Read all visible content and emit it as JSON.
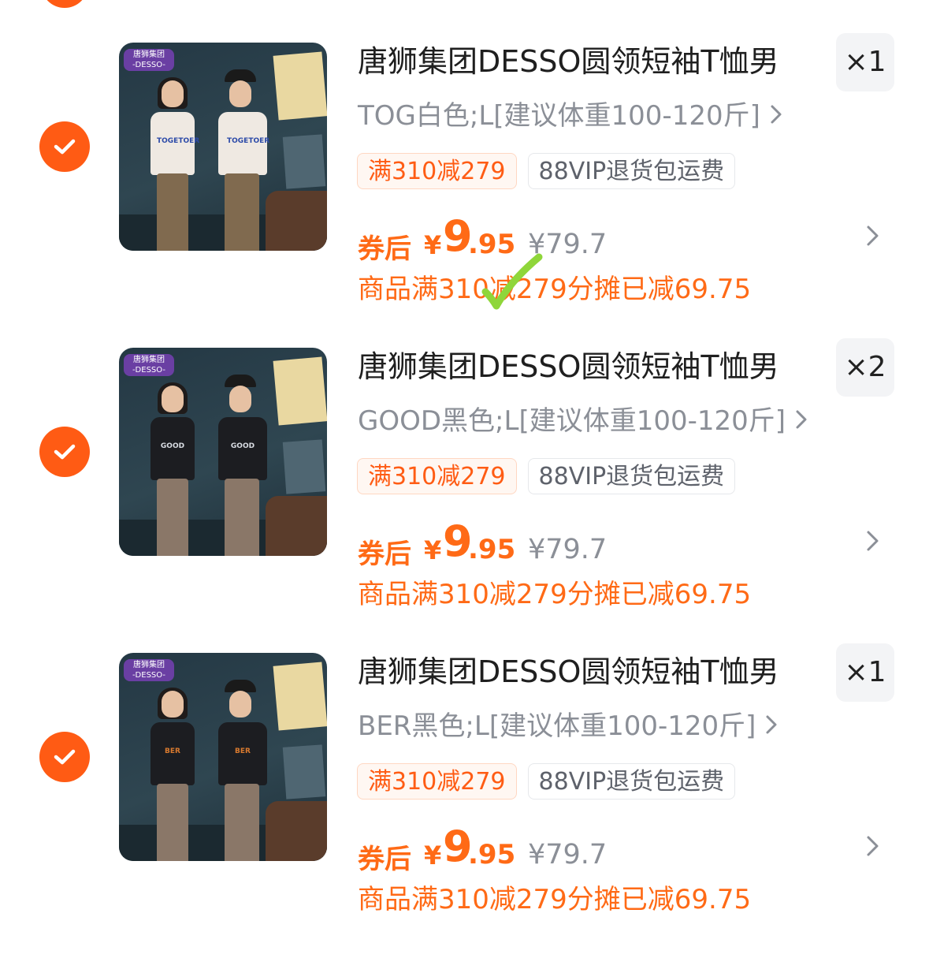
{
  "items": [
    {
      "title": "唐狮集团DESSO圆领短袖T恤男",
      "sku": "TOG白色;L[建议体重100-120斤]",
      "quantity": "×1",
      "tags": [
        "满310减279",
        "88VIP退货包运费"
      ],
      "coupon_label": "券后",
      "currency": "¥",
      "price_integer": "9",
      "price_decimal": ".95",
      "original_price": "¥79.7",
      "allocation_note": "商品满310减279分摊已减69.75",
      "brand_badge": [
        "唐狮集团",
        "-DESSO-"
      ],
      "shirt_color": "#efe9e2",
      "shirt_print": "TOGETOER",
      "print_color": "#2c4aa8",
      "pants_color": "#806a4f",
      "selected": true
    },
    {
      "title": "唐狮集团DESSO圆领短袖T恤男",
      "sku": "GOOD黑色;L[建议体重100-120斤]",
      "quantity": "×2",
      "tags": [
        "满310减279",
        "88VIP退货包运费"
      ],
      "coupon_label": "券后",
      "currency": "¥",
      "price_integer": "9",
      "price_decimal": ".95",
      "original_price": "¥79.7",
      "allocation_note": "商品满310减279分摊已减69.75",
      "brand_badge": [
        "唐狮集团",
        "-DESSO-"
      ],
      "shirt_color": "#1c1d21",
      "shirt_print": "GOOD",
      "print_color": "#d9dde3",
      "pants_color": "#8a7768",
      "selected": true
    },
    {
      "title": "唐狮集团DESSO圆领短袖T恤男",
      "sku": "BER黑色;L[建议体重100-120斤]",
      "quantity": "×1",
      "tags": [
        "满310减279",
        "88VIP退货包运费"
      ],
      "coupon_label": "券后",
      "currency": "¥",
      "price_integer": "9",
      "price_decimal": ".95",
      "original_price": "¥79.7",
      "allocation_note": "商品满310减279分摊已减69.75",
      "brand_badge": [
        "唐狮集团",
        "-DESSO-"
      ],
      "shirt_color": "#1c1d21",
      "shirt_print": "BER",
      "print_color": "#d97a2f",
      "pants_color": "#8a7768",
      "selected": true
    }
  ],
  "colors": {
    "accent": "#ff5b14",
    "price": "#ff6a16",
    "muted": "#8b8f97",
    "title": "#1f1f1f",
    "quantity_bg": "#f3f4f6"
  }
}
